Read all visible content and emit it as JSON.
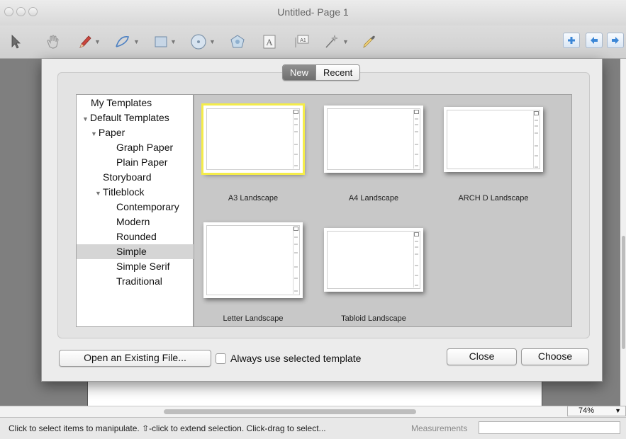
{
  "window": {
    "title": "Untitled- Page 1"
  },
  "toolbar": {
    "tools": [
      {
        "name": "arrow-select-icon"
      },
      {
        "name": "hand-pan-icon"
      },
      {
        "name": "pencil-icon"
      },
      {
        "name": "curve-line-icon"
      },
      {
        "name": "rectangle-icon"
      },
      {
        "name": "circle-icon"
      },
      {
        "name": "polygon-icon"
      },
      {
        "name": "text-tool-icon"
      },
      {
        "name": "dimension-text-icon"
      },
      {
        "name": "magic-wand-icon"
      },
      {
        "name": "eyedropper-icon"
      }
    ],
    "text_glyph": "A",
    "dim_glyph": "A1",
    "right_buttons": [
      "add-page-icon",
      "previous-page-icon",
      "next-page-icon"
    ]
  },
  "dialog": {
    "tabs": {
      "new": "New",
      "recent": "Recent",
      "active": "new"
    },
    "tree": [
      {
        "label": "My Templates",
        "level": 1,
        "expanded": null,
        "selected": false
      },
      {
        "label": "Default Templates",
        "level": 0,
        "expanded": true,
        "selected": false
      },
      {
        "label": "Paper",
        "level": 1,
        "expanded": true,
        "selected": false
      },
      {
        "label": "Graph Paper",
        "level": 2,
        "expanded": null,
        "selected": false
      },
      {
        "label": "Plain Paper",
        "level": 2,
        "expanded": null,
        "selected": false
      },
      {
        "label": "Storyboard",
        "level": 1,
        "expanded": null,
        "selected": false
      },
      {
        "label": "Titleblock",
        "level": 1,
        "expanded": true,
        "selected": false
      },
      {
        "label": "Contemporary",
        "level": 2,
        "expanded": null,
        "selected": false
      },
      {
        "label": "Modern",
        "level": 2,
        "expanded": null,
        "selected": false
      },
      {
        "label": "Rounded",
        "level": 2,
        "expanded": null,
        "selected": false
      },
      {
        "label": "Simple",
        "level": 2,
        "expanded": null,
        "selected": true
      },
      {
        "label": "Simple Serif",
        "level": 2,
        "expanded": null,
        "selected": false
      },
      {
        "label": "Traditional",
        "level": 2,
        "expanded": null,
        "selected": false
      }
    ],
    "templates": [
      {
        "label": "A3 Landscape",
        "selected": true
      },
      {
        "label": "A4 Landscape",
        "selected": false
      },
      {
        "label": "ARCH D Landscape",
        "selected": false
      },
      {
        "label": "Letter Landscape",
        "selected": false
      },
      {
        "label": "Tabloid Landscape",
        "selected": false
      }
    ],
    "open_existing": "Open an Existing File...",
    "always_use": "Always use selected template",
    "always_use_checked": false,
    "close": "Close",
    "choose": "Choose"
  },
  "statusbar": {
    "text": "Click to select items to manipulate. ⇧-click to extend selection. Click-drag to select...",
    "measurements_label": "Measurements",
    "measurements_value": "",
    "zoom": "74%"
  },
  "colors": {
    "selection_outline": "#f4ec4a",
    "selected_row": "#d5d5d5",
    "active_tab": "#7a7a7a",
    "nav_button_blue": "#3b86d6"
  }
}
